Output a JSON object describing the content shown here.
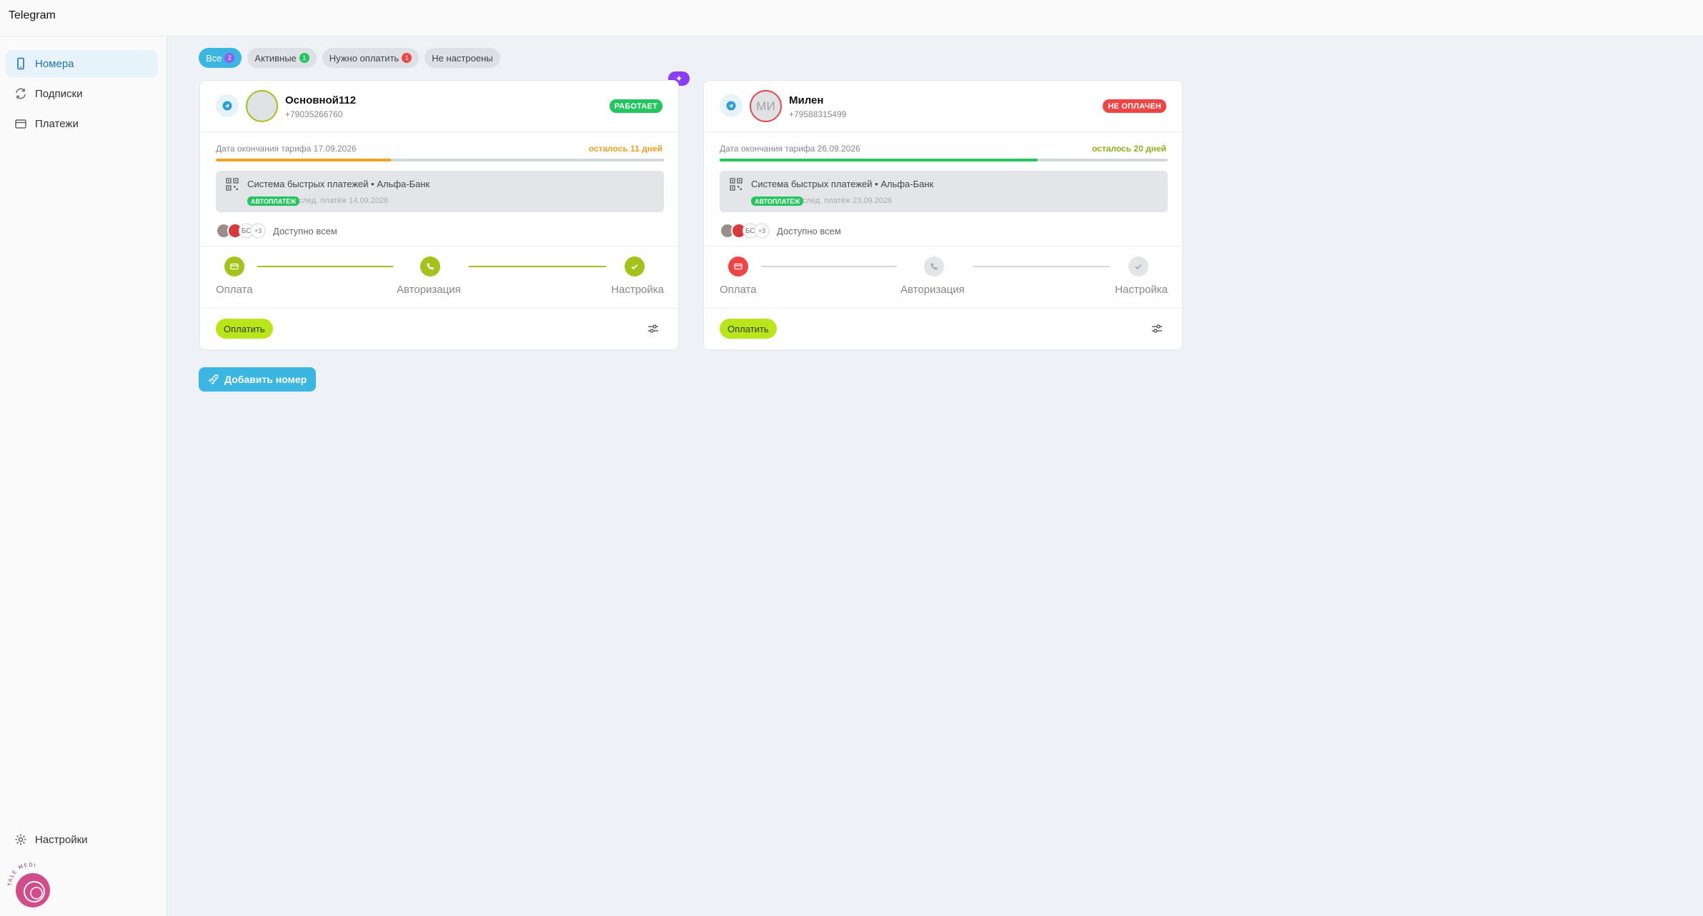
{
  "app": {
    "title": "Telegram"
  },
  "sidebar": {
    "items": [
      {
        "label": "Номера",
        "icon": "phone-icon",
        "active": true
      },
      {
        "label": "Подписки",
        "icon": "refresh-icon",
        "active": false
      },
      {
        "label": "Платежи",
        "icon": "folder-icon",
        "active": false
      }
    ],
    "settings_label": "Настройки",
    "logo_text": "TALE MEDIA"
  },
  "filters": [
    {
      "label": "Все",
      "count": "2",
      "active": true
    },
    {
      "label": "Активные",
      "count": "1",
      "active": false
    },
    {
      "label": "Нужно оплатить",
      "count": "1",
      "active": false
    },
    {
      "label": "Не настроены",
      "count": "",
      "active": false
    }
  ],
  "cards": [
    {
      "name": "Основной112",
      "phone": "+79035266760",
      "avatar_initials": "",
      "status": "РАБОТАЕТ",
      "status_color": "#22c55e",
      "tariff_end": "Дата окончания тарифа 17.09.2026",
      "remaining": "осталось 11 дней",
      "progress_fraction": 0.39,
      "payment_method": "Система быстрых платежей • Альфа-Банк",
      "autopay": "АВТОПЛАТЁЖ",
      "next_payment": "след. платёж 14.09.2026",
      "users_initials": "БО",
      "users_more": "+3",
      "access": "Доступно всем",
      "steps": [
        "Оплата",
        "Авторизация",
        "Настройка"
      ],
      "pay_button": "Оплатить"
    },
    {
      "name": "Милен",
      "phone": "+79588315499",
      "avatar_initials": "МИ",
      "status": "НЕ ОПЛАЧЕН",
      "status_color": "#ef4444",
      "tariff_end": "Дата окончания тарифа 26.09.2026",
      "remaining": "осталось 20 дней",
      "progress_fraction": 0.71,
      "payment_method": "Система быстрых платежей • Альфа-Банк",
      "autopay": "АВТОПЛАТЁЖ",
      "next_payment": "след. платёж 23.09.2026",
      "users_initials": "БО",
      "users_more": "+3",
      "access": "Доступно всем",
      "steps": [
        "Оплата",
        "Авторизация",
        "Настройка"
      ],
      "pay_button": "Оплатить"
    }
  ],
  "add_button": "Добавить номер",
  "colors": {
    "accent": "#3bb6e3",
    "success": "#22c55e",
    "danger": "#ef4444",
    "lime": "#b8e61a"
  }
}
